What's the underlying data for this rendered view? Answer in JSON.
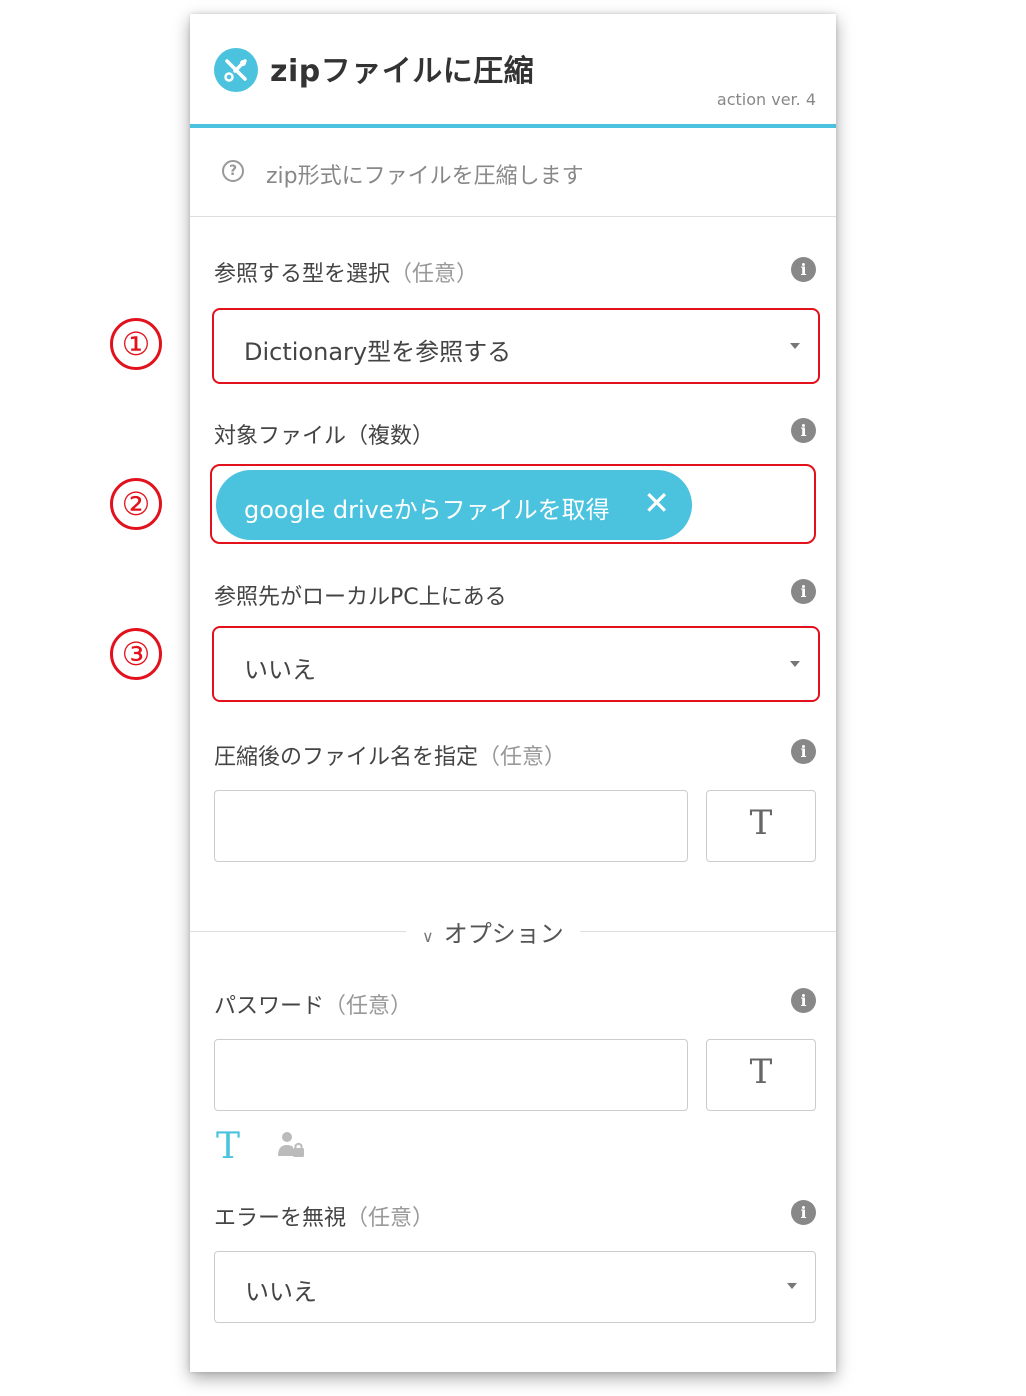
{
  "header": {
    "title": "zipファイルに圧縮",
    "version": "action ver. 4",
    "logo_icon": "tools-icon"
  },
  "description": {
    "icon": "question-icon",
    "text": "zip形式にファイルを圧縮します"
  },
  "fields": {
    "ref_type": {
      "label": "参照する型を選択",
      "optional": "（任意）",
      "value": "Dictionary型を参照する"
    },
    "target_files": {
      "label": "対象ファイル（複数）",
      "chip_label": "google driveからファイルを取得",
      "chip_remove": "✕"
    },
    "local_pc": {
      "label": "参照先がローカルPC上にある",
      "value": "いいえ"
    },
    "output_name": {
      "label": "圧縮後のファイル名を指定",
      "optional": "（任意）",
      "text_button": "T"
    },
    "options_toggle": {
      "chevron": "∨",
      "label": "オプション"
    },
    "password": {
      "label": "パスワード",
      "optional": "（任意）",
      "text_button": "T",
      "mode_text": "T"
    },
    "ignore_error": {
      "label": "エラーを無視",
      "optional": "（任意）",
      "value": "いいえ"
    }
  },
  "info_glyph": "i",
  "annotations": [
    "①",
    "②",
    "③"
  ],
  "colors": {
    "accent": "#4cc3de",
    "annotation_red": "#e2111b"
  }
}
